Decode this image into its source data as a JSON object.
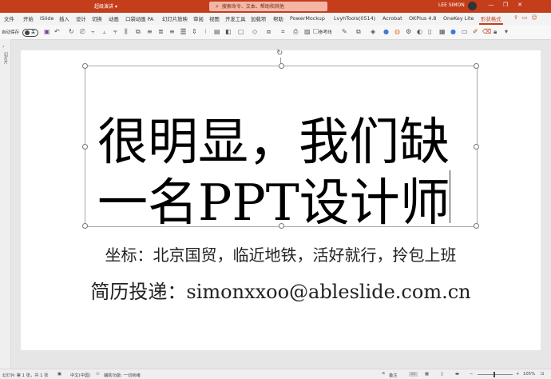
{
  "titlebar": {
    "doc_name": "超级演讲 ▾",
    "search_placeholder": "搜索命令、文本、帮助和其他",
    "user_name": "LEE SIMON",
    "min": "—",
    "restore": "❐",
    "close": "✕"
  },
  "tabs": [
    "文件",
    "开始",
    "iSlide",
    "插入",
    "设计",
    "切换",
    "动画",
    "口袋动画 PA",
    "幻灯片放映",
    "审阅",
    "视图",
    "开发工具",
    "加载项",
    "帮助",
    "PowerMockup",
    "LvyhTools(0514)",
    "Acrobat",
    "OKPlus 4.8",
    "OneKey Lite",
    "形状格式"
  ],
  "toolbar": {
    "autosave_label": "自动保存",
    "autosave_state": "关",
    "reference_line": "参考线"
  },
  "left_pane": {
    "label": "幻灯片"
  },
  "slide": {
    "title_line1": "很明显，我们缺",
    "title_line2": "一名PPT设计师",
    "subtitle1": "坐标：北京国贸，临近地铁，活好就行，拎包上班",
    "subtitle2": "简历投递：simonxxoo@ableslide.com.cn"
  },
  "status": {
    "slide_info": "幻灯片 第 1 张，共 1 张",
    "language": "中文(中国)",
    "accessibility": "辅助功能: 一切就绪",
    "notes": "备注",
    "zoom": "105%"
  },
  "colors": {
    "accent": "#c43e1c",
    "search_bg": "#f3b6a6"
  }
}
